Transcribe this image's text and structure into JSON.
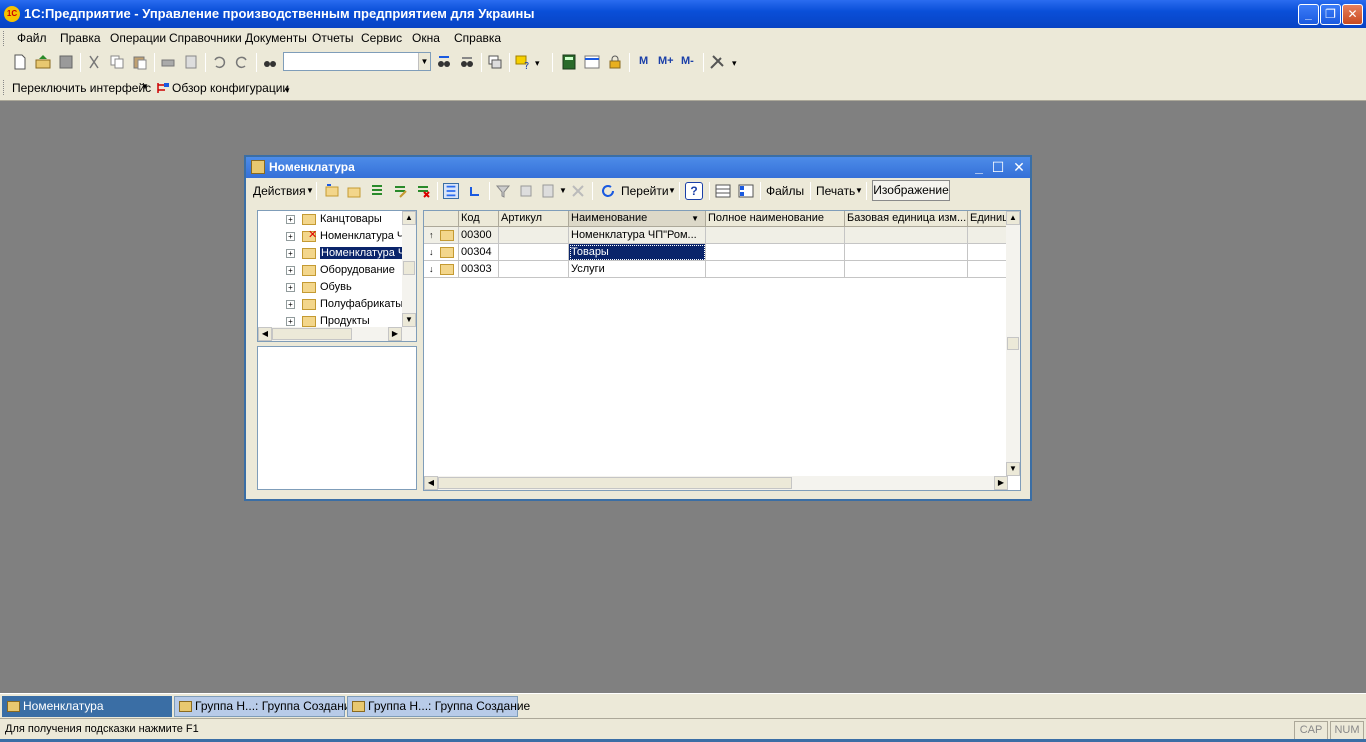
{
  "window": {
    "title": "1С:Предприятие - Управление производственным предприятием для Украины",
    "app_icon_text": "1С",
    "minimize": "_",
    "restore": "❐",
    "close": "✕"
  },
  "menu": [
    "Файл",
    "Правка",
    "Операции",
    "Справочники",
    "Документы",
    "Отчеты",
    "Сервис",
    "Окна",
    "Справка"
  ],
  "toolbar": {
    "search_value": "",
    "memory_buttons": [
      "M",
      "M+",
      "M-"
    ]
  },
  "toolbar2": {
    "switch_interface": "Переключить интерфейс",
    "config_overview": "Обзор конфигурации"
  },
  "child_window": {
    "title": "Номенклатура",
    "actions": "Действия",
    "goto": "Перейти",
    "help": "?",
    "files": "Файлы",
    "print": "Печать",
    "image": "Изображение",
    "minimize": "_",
    "maximize": "☐",
    "close": "✕"
  },
  "tree": {
    "items": [
      {
        "label": "Канцтовары",
        "deleted": false,
        "selected": false
      },
      {
        "label": "Номенклатура Ч",
        "deleted": true,
        "selected": false
      },
      {
        "label": "Номенклатура Ч",
        "deleted": false,
        "selected": true
      },
      {
        "label": "Оборудование",
        "deleted": false,
        "selected": false
      },
      {
        "label": "Обувь",
        "deleted": false,
        "selected": false
      },
      {
        "label": "Полуфабрикаты",
        "deleted": false,
        "selected": false
      },
      {
        "label": "Продукты",
        "deleted": false,
        "selected": false
      }
    ]
  },
  "grid": {
    "columns": [
      "",
      "Код",
      "Артикул",
      "Наименование",
      "Полное наименование",
      "Базовая единица изм...",
      "Единиц"
    ],
    "rows": [
      {
        "arrow": "↑",
        "code": "00300",
        "article": "",
        "name": "Номенклатура ЧП\"Ром...",
        "fullname": "",
        "unit": "",
        "unit2": "",
        "selected": false
      },
      {
        "arrow": "↓",
        "code": "00304",
        "article": "",
        "name": "Товары",
        "fullname": "",
        "unit": "",
        "unit2": "",
        "selected": true
      },
      {
        "arrow": "↓",
        "code": "00303",
        "article": "",
        "name": "Услуги",
        "fullname": "",
        "unit": "",
        "unit2": "",
        "selected": false
      }
    ]
  },
  "taskbar": [
    {
      "label": "Номенклатура",
      "active": true
    },
    {
      "label": "Группа Н...: Группа Создание",
      "active": false
    },
    {
      "label": "Группа Н...: Группа Создание",
      "active": false
    }
  ],
  "status": {
    "hint": "Для получения подсказки нажмите F1",
    "cap": "CAP",
    "num": "NUM"
  }
}
